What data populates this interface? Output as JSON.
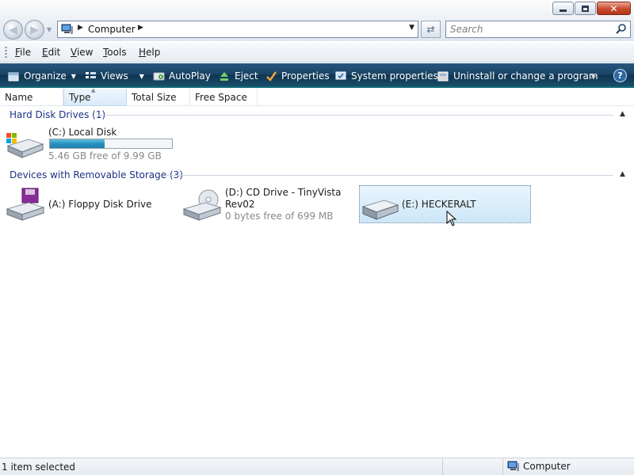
{
  "window": {
    "controls": {
      "minimize_icon": "minimize-icon",
      "maximize_icon": "maximize-icon",
      "close_icon": "close-icon"
    }
  },
  "address_bar": {
    "location": "Computer",
    "search_placeholder": "Search"
  },
  "menu": {
    "items": [
      {
        "label": "File",
        "accel": "F",
        "rest": "ile"
      },
      {
        "label": "Edit",
        "accel": "E",
        "rest": "dit"
      },
      {
        "label": "View",
        "accel": "V",
        "rest": "iew"
      },
      {
        "label": "Tools",
        "accel": "T",
        "rest": "ools"
      },
      {
        "label": "Help",
        "accel": "H",
        "rest": "elp"
      }
    ]
  },
  "command_bar": {
    "organize": "Organize",
    "views": "Views",
    "autoplay": "AutoPlay",
    "eject": "Eject",
    "properties": "Properties",
    "system_properties": "System properties",
    "uninstall": "Uninstall or change a program",
    "more": "»"
  },
  "columns": [
    "Name",
    "Type",
    "Total Size",
    "Free Space"
  ],
  "groups": {
    "hard_disks": {
      "header": "Hard Disk Drives (1)",
      "items": [
        {
          "name": "(C:) Local Disk",
          "detail": "5.46 GB free of 9.99 GB",
          "used_fraction": 0.45
        }
      ]
    },
    "removable": {
      "header": "Devices with Removable Storage (3)",
      "items": [
        {
          "name": "(A:) Floppy Disk Drive"
        },
        {
          "name_line1": "(D:) CD Drive - TinyVista",
          "name_line2": "Rev02",
          "detail": "0 bytes free of 699 MB"
        },
        {
          "name": "(E:) HECKERALT"
        }
      ]
    }
  },
  "status": {
    "selection": "1 item selected",
    "location": "Computer"
  },
  "colors": {
    "command_bar": "#1b4466",
    "group_header": "#1e3287",
    "capacity_fill": "#2991bf",
    "selection": "#cde7f8"
  }
}
